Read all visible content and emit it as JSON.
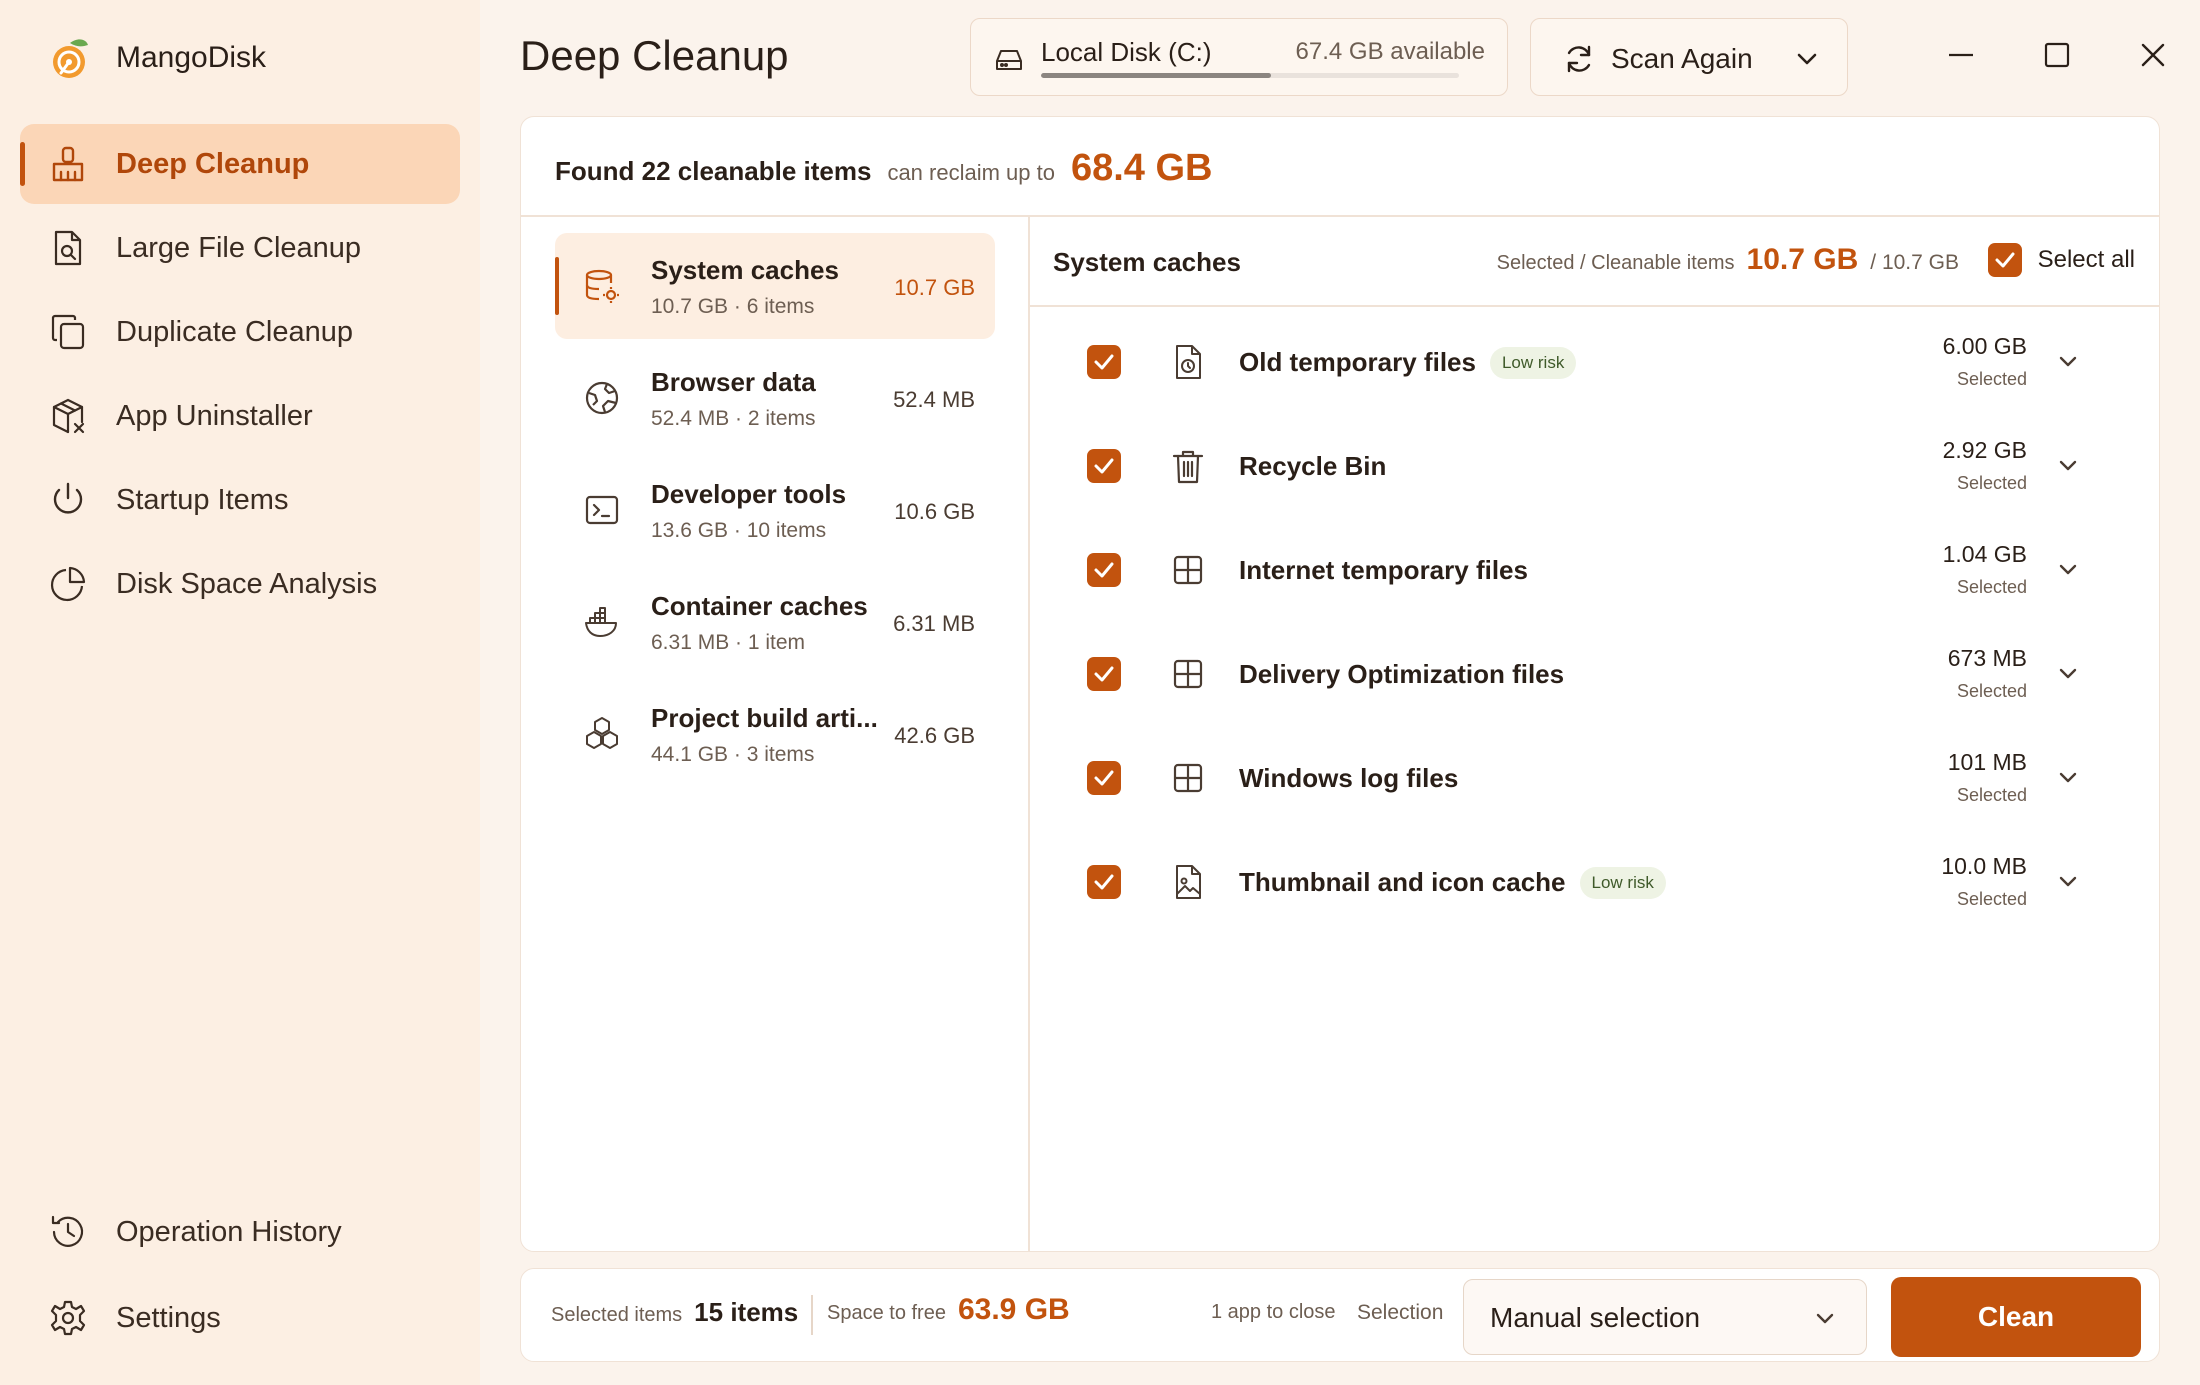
{
  "app": {
    "name": "MangoDisk"
  },
  "sidebar": {
    "items": [
      {
        "label": "Deep Cleanup",
        "icon": "broom-icon",
        "active": true
      },
      {
        "label": "Large File Cleanup",
        "icon": "file-search-icon"
      },
      {
        "label": "Duplicate Cleanup",
        "icon": "copy-icon"
      },
      {
        "label": "App Uninstaller",
        "icon": "package-x-icon"
      },
      {
        "label": "Startup Items",
        "icon": "power-icon"
      },
      {
        "label": "Disk Space Analysis",
        "icon": "pie-chart-icon"
      }
    ],
    "bottom_items": [
      {
        "label": "Operation History",
        "icon": "history-icon"
      },
      {
        "label": "Settings",
        "icon": "gear-icon"
      }
    ]
  },
  "header": {
    "title": "Deep Cleanup",
    "disk": {
      "label": "Local Disk (C:)",
      "available": "67.4 GB available",
      "used_fraction": 0.55
    },
    "scan_button": "Scan Again"
  },
  "summary": {
    "found": "Found 22 cleanable items",
    "reclaim_label": "can reclaim up to",
    "reclaim_amount": "68.4 GB"
  },
  "categories": [
    {
      "name": "System caches",
      "sub": "10.7 GB · 6 items",
      "size": "10.7 GB",
      "icon": "database-gear-icon",
      "active": true
    },
    {
      "name": "Browser data",
      "sub": "52.4 MB · 2 items",
      "size": "52.4 MB",
      "icon": "globe-icon"
    },
    {
      "name": "Developer tools",
      "sub": "13.6 GB · 10 items",
      "size": "10.6 GB",
      "icon": "terminal-icon"
    },
    {
      "name": "Container caches",
      "sub": "6.31 MB · 1 item",
      "size": "6.31 MB",
      "icon": "docker-icon"
    },
    {
      "name": "Project build arti...",
      "sub": "44.1 GB · 3 items",
      "size": "42.6 GB",
      "icon": "boxes-icon"
    }
  ],
  "detail": {
    "title": "System caches",
    "selected_label": "Selected / Cleanable items",
    "selected_value": "10.7 GB",
    "total_value": "/ 10.7 GB",
    "select_all": "Select all",
    "rows": [
      {
        "name": "Old temporary files",
        "risk": "Low risk",
        "size": "6.00 GB",
        "state": "Selected",
        "icon": "file-clock-icon",
        "checked": true
      },
      {
        "name": "Recycle Bin",
        "risk": "",
        "size": "2.92 GB",
        "state": "Selected",
        "icon": "trash-icon",
        "checked": true
      },
      {
        "name": "Internet temporary files",
        "risk": "",
        "size": "1.04 GB",
        "state": "Selected",
        "icon": "windows-icon",
        "checked": true
      },
      {
        "name": "Delivery Optimization files",
        "risk": "",
        "size": "673 MB",
        "state": "Selected",
        "icon": "windows-icon",
        "checked": true
      },
      {
        "name": "Windows log files",
        "risk": "",
        "size": "101 MB",
        "state": "Selected",
        "icon": "windows-icon",
        "checked": true
      },
      {
        "name": "Thumbnail and icon cache",
        "risk": "Low risk",
        "size": "10.0 MB",
        "state": "Selected",
        "icon": "file-image-icon",
        "checked": true
      }
    ]
  },
  "footer": {
    "selected_items_label": "Selected items",
    "selected_items_value": "15 items",
    "space_label": "Space to free",
    "space_value": "63.9 GB",
    "apps_to_close": "1 app to close",
    "selection_label": "Selection",
    "selection_value": "Manual selection",
    "clean_button": "Clean"
  },
  "colors": {
    "accent": "#c2530e",
    "sidebar_bg": "#fcefe3",
    "active_nav_bg": "#fbd6b7",
    "risk_bg": "#eef3e4"
  }
}
